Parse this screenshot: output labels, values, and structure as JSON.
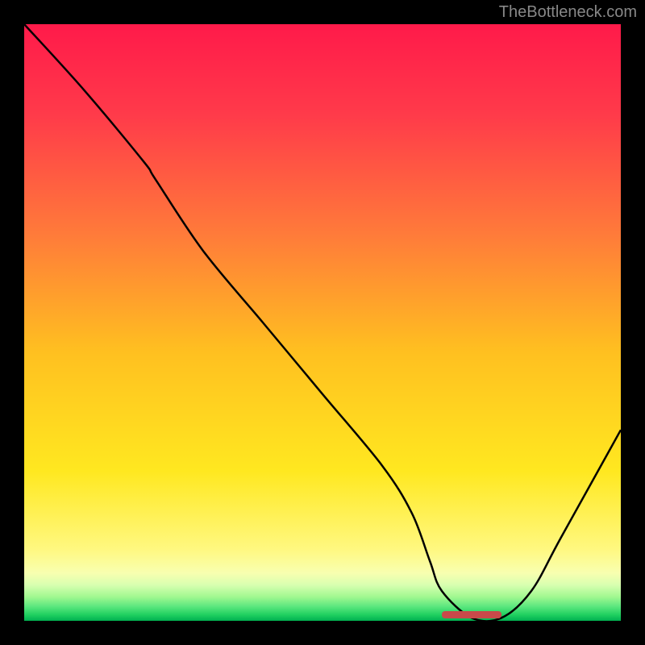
{
  "watermark": "TheBottleneck.com",
  "chart_data": {
    "type": "line",
    "title": "",
    "xlabel": "",
    "ylabel": "",
    "xlim": [
      0,
      100
    ],
    "ylim": [
      0,
      100
    ],
    "series": [
      {
        "name": "bottleneck-curve",
        "x": [
          0,
          10,
          20,
          22,
          30,
          40,
          50,
          60,
          65,
          68,
          70,
          75,
          80,
          85,
          90,
          100
        ],
        "values": [
          100,
          89,
          77,
          74,
          62,
          50,
          38,
          26,
          18,
          10,
          5,
          0.5,
          0.5,
          5,
          14,
          32
        ]
      }
    ],
    "optimal_zone": {
      "x_start": 70,
      "x_end": 80
    },
    "gradient_stops": [
      {
        "pos": 0.0,
        "color": "#ff1a4a"
      },
      {
        "pos": 0.15,
        "color": "#ff3a4a"
      },
      {
        "pos": 0.35,
        "color": "#ff7a3a"
      },
      {
        "pos": 0.55,
        "color": "#ffc020"
      },
      {
        "pos": 0.75,
        "color": "#ffe820"
      },
      {
        "pos": 0.88,
        "color": "#fff880"
      },
      {
        "pos": 0.92,
        "color": "#f8ffb0"
      },
      {
        "pos": 0.94,
        "color": "#d8ffb0"
      },
      {
        "pos": 0.96,
        "color": "#a0f890"
      },
      {
        "pos": 0.975,
        "color": "#60e880"
      },
      {
        "pos": 0.99,
        "color": "#20d060"
      },
      {
        "pos": 1.0,
        "color": "#00b050"
      }
    ]
  }
}
